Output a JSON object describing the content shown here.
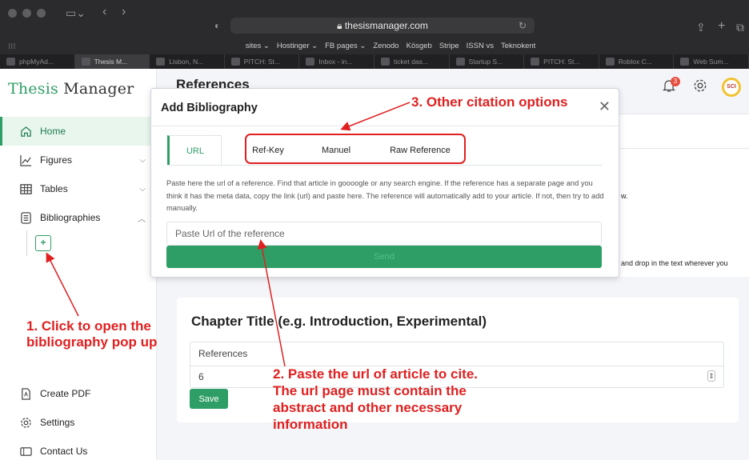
{
  "browser": {
    "url": "thesismanager.com",
    "bookmarks": [
      "sites ⌄",
      "Hostinger ⌄",
      "FB pages ⌄",
      "Zenodo",
      "Kösgeb",
      "Stripe",
      "ISSN vs",
      "Teknokent"
    ],
    "tabs": [
      "phpMyAd...",
      "Thesis M...",
      "Lisbon, N...",
      "PITCH: St...",
      "Inbox - in...",
      "ticket das...",
      "Startup S...",
      "PITCH: St...",
      "Roblox C...",
      "Web Sum..."
    ]
  },
  "app": {
    "logo_primary": "Thesis",
    "logo_secondary": "Manager",
    "page_title": "References",
    "notification_count": "3",
    "avatar_text": "SCI"
  },
  "sidebar": {
    "items": [
      {
        "label": "Home",
        "icon": "home-icon"
      },
      {
        "label": "Figures",
        "icon": "chart-icon"
      },
      {
        "label": "Tables",
        "icon": "table-icon"
      },
      {
        "label": "Bibliographies",
        "icon": "list-icon"
      }
    ],
    "footer": [
      {
        "label": "Create PDF",
        "icon": "pdf-icon"
      },
      {
        "label": "Settings",
        "icon": "gear-icon"
      },
      {
        "label": "Contact Us",
        "icon": "contact-icon"
      }
    ]
  },
  "modal": {
    "title": "Add Bibliography",
    "tabs": [
      "URL",
      "Ref-Key",
      "Manuel",
      "Raw Reference"
    ],
    "description": "Paste here the url of a reference. Find that article in goooogle or any search engine. If the reference has a separate page and you think it has the meta data, copy the link (url) and paste here. The reference will automatically add to your article. If not, then try to add manually.",
    "input_placeholder": "Paste Url of the reference",
    "send_label": "Send"
  },
  "background_text": {
    "fragment1": "w.",
    "fragment2": "and drop in the text wherever you"
  },
  "chapter": {
    "title": "Chapter Title (e.g. Introduction, Experimental)",
    "references_label": "References",
    "references_value": "6",
    "save_label": "Save"
  },
  "annotations": {
    "step1_line1": "1. Click to open the",
    "step1_line2": "bibliography pop up",
    "step2_line1": "2. Paste the url of article to cite.",
    "step2_line2": "The url page must contain the",
    "step2_line3": "abstract and other necessary",
    "step2_line4": "information",
    "step3": "3. Other citation options",
    "color": "#e02020"
  },
  "colors": {
    "accent": "#2f9e66",
    "chrome": "#2b2b2d"
  }
}
